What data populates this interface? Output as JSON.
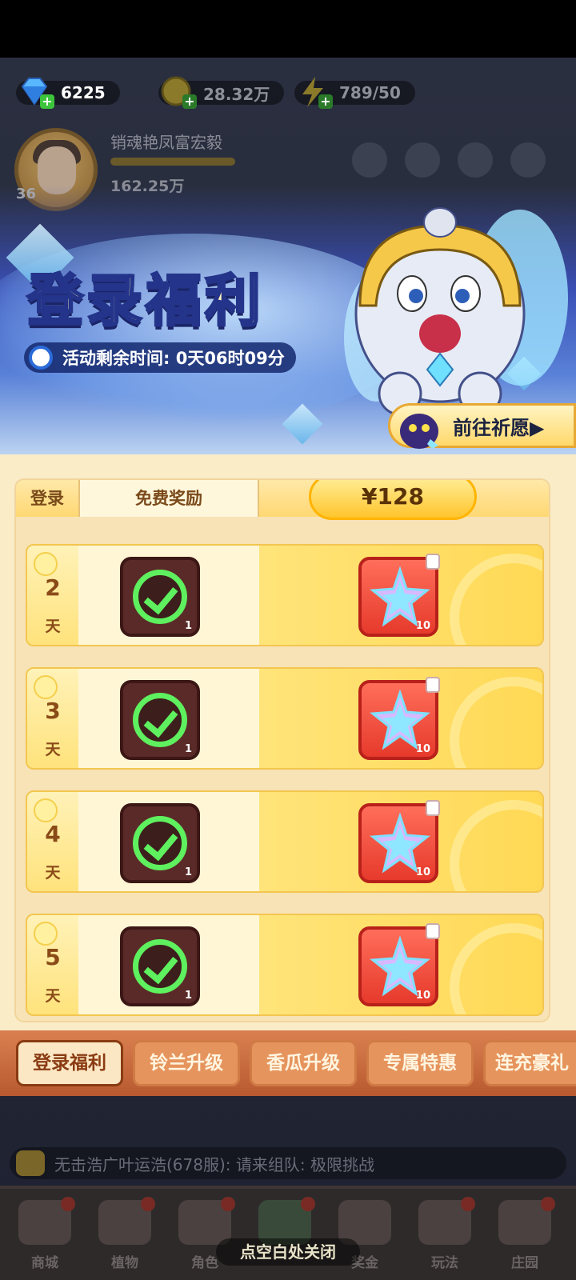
{
  "resources": {
    "diamonds": "6225",
    "gold": "28.32万",
    "energy": "789/50"
  },
  "player": {
    "name": "销魂艳凤富宏毅",
    "level": "36",
    "gold": "162.25万"
  },
  "banner": {
    "title": "登录福利",
    "timer": "活动剩余时间: 0天06时09分",
    "goto_label": "前往祈愿▶"
  },
  "table": {
    "col_login": "登录",
    "col_free": "免费奖励",
    "price": "¥128"
  },
  "rows": [
    {
      "day": "2",
      "unit": "天",
      "free_qty": "1",
      "pay_qty": "10"
    },
    {
      "day": "3",
      "unit": "天",
      "free_qty": "1",
      "pay_qty": "10"
    },
    {
      "day": "4",
      "unit": "天",
      "free_qty": "1",
      "pay_qty": "10"
    },
    {
      "day": "5",
      "unit": "天",
      "free_qty": "1",
      "pay_qty": "10"
    }
  ],
  "tabs": [
    "登录福利",
    "铃兰升级",
    "香瓜升级",
    "专属特惠",
    "连充豪礼"
  ],
  "chat": "无击浩广叶运浩(678服): 请来组队: 极限挑战",
  "nav": [
    "商城",
    "植物",
    "角色",
    "",
    "奖金",
    "玩法",
    "庄园"
  ],
  "close_hint": "点空白处关闭",
  "colors": {
    "accent_gold": "#ffc52c",
    "tab_active_text": "#8a3b12",
    "check_green": "#5ef05e",
    "pay_item_red": "#e63a2c"
  }
}
